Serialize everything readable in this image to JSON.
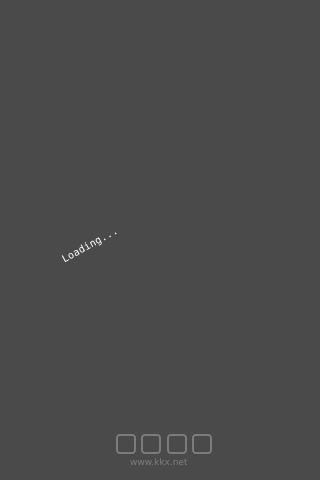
{
  "screen": {
    "status": "Loading...",
    "background_color": "#4a4a4a",
    "text_color": "#ffffff"
  },
  "watermark": {
    "url": "www.kkx.net"
  }
}
